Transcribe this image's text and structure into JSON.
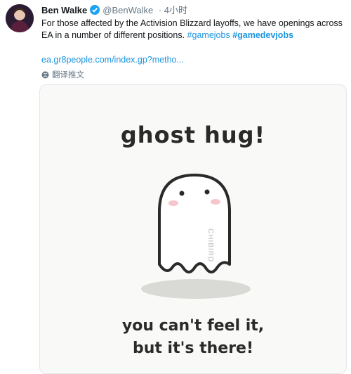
{
  "tweet": {
    "name": "Ben Walke",
    "handle": "@BenWalke",
    "time": "· 4小时",
    "text_main": "For those affected by the Activision Blizzard layoffs, we have openings across EA in a number of different positions.",
    "hashtag1": "#gamejobs",
    "hashtag2": "#gamedevjobs",
    "link": "ea.gr8people.com/index.gp?metho...",
    "translate_label": "翻译推文"
  },
  "image": {
    "title": "ghost hug!",
    "watermark": "CHIBIRD",
    "caption_line1": "you can't feel it,",
    "caption_line2": "but it's there!"
  },
  "colors": {
    "link": "#1b95e0",
    "verified": "#1da1f2",
    "muted": "#657786"
  }
}
